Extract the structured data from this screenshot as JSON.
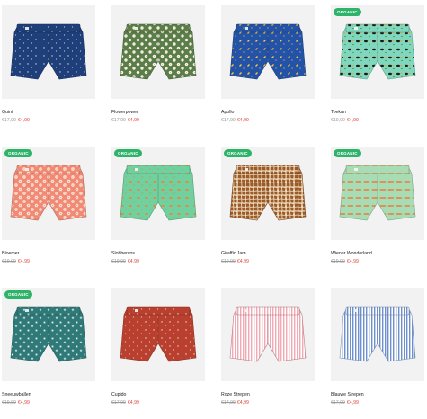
{
  "badge_label": "ORGANIC",
  "products": [
    {
      "name": "Quint",
      "old_price": "€17,99",
      "new_price": "€4,99",
      "organic": false,
      "color": "#1f3f7a",
      "pattern": "dots-white",
      "pattern_icon": "speckle"
    },
    {
      "name": "Flowerpower",
      "old_price": "€17,99",
      "new_price": "€4,99",
      "organic": false,
      "color": "#5b7d4a",
      "pattern": "flowers-white",
      "pattern_icon": "flower"
    },
    {
      "name": "Apollo",
      "old_price": "€17,99",
      "new_price": "€4,99",
      "organic": false,
      "color": "#2453a6",
      "pattern": "rockets",
      "pattern_icon": "rocket"
    },
    {
      "name": "Toekan",
      "old_price": "€19,99",
      "new_price": "€4,99",
      "organic": true,
      "color": "#7fd8bd",
      "pattern": "toucans",
      "pattern_icon": "toucan"
    },
    {
      "name": "Bloemer",
      "old_price": "€19,99",
      "new_price": "€4,99",
      "organic": true,
      "color": "#f08a74",
      "pattern": "flowers-light",
      "pattern_icon": "flower"
    },
    {
      "name": "Slobbervos",
      "old_price": "€19,99",
      "new_price": "€4,99",
      "organic": true,
      "color": "#6fd1a0",
      "pattern": "foxes",
      "pattern_icon": "fox"
    },
    {
      "name": "Giraffic Jam",
      "old_price": "€19,99",
      "new_price": "€4,99",
      "organic": true,
      "color": "#9a5a2a",
      "pattern": "giraffe",
      "pattern_icon": "giraffe-spots"
    },
    {
      "name": "Wiener Wonderland",
      "old_price": "€19,99",
      "new_price": "€4,99",
      "organic": true,
      "color": "#a8dcb4",
      "pattern": "hotdogs",
      "pattern_icon": "hotdog"
    },
    {
      "name": "Sneeuwballen",
      "old_price": "€19,99",
      "new_price": "€4,99",
      "organic": true,
      "color": "#2f7a78",
      "pattern": "snowflakes",
      "pattern_icon": "snowflake"
    },
    {
      "name": "Cupido",
      "old_price": "€17,99",
      "new_price": "€4,99",
      "organic": false,
      "color": "#b9402f",
      "pattern": "dots-small",
      "pattern_icon": "speckle"
    },
    {
      "name": "Roze Strepen",
      "old_price": "€17,99",
      "new_price": "€4,99",
      "organic": false,
      "color": "#f1a9b4",
      "pattern": "stripes-pink",
      "pattern_icon": "stripe"
    },
    {
      "name": "Blauwe Strepen",
      "old_price": "€17,99",
      "new_price": "€4,99",
      "organic": false,
      "color": "#a9c2e6",
      "pattern": "stripes-blue",
      "pattern_icon": "stripe"
    }
  ]
}
